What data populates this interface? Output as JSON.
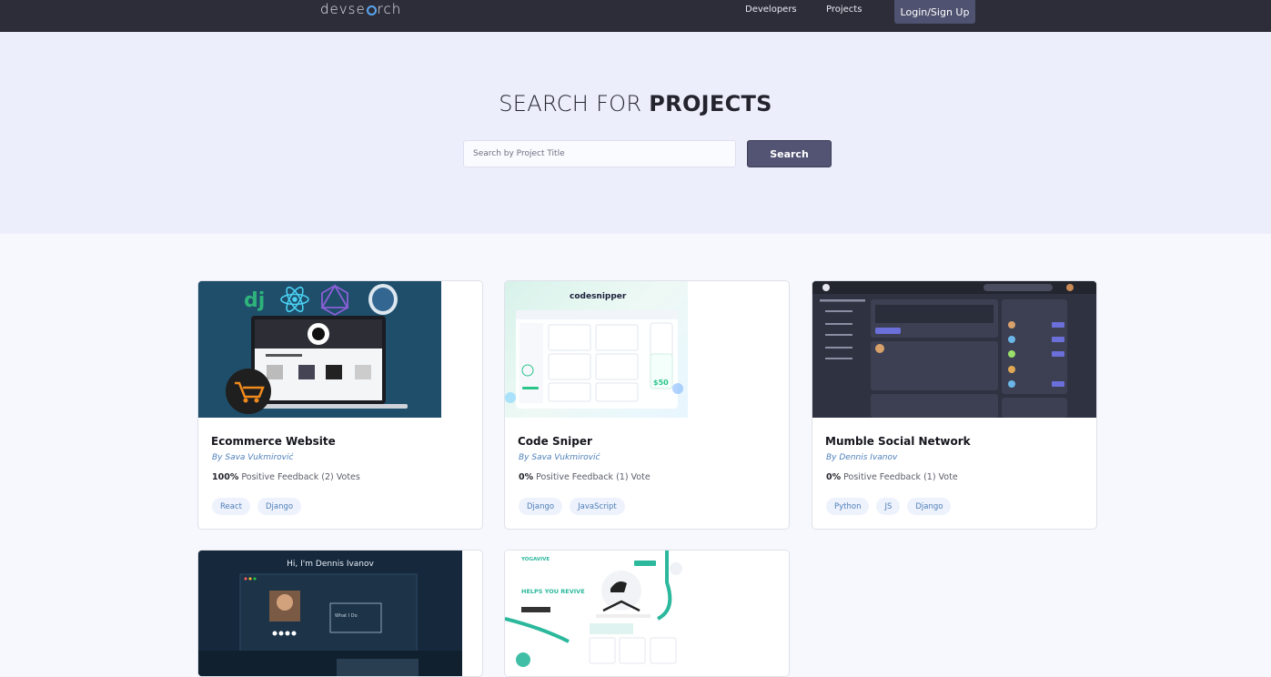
{
  "app": {
    "logo_prefix": "devse",
    "logo_suffix": "rch"
  },
  "nav": {
    "developers": "Developers",
    "projects": "Projects",
    "login": "Login/Sign Up"
  },
  "hero": {
    "title_light": "SEARCH FOR ",
    "title_bold": "PROJECTS",
    "search_placeholder": "Search by Project Title",
    "search_button": "Search"
  },
  "projects": [
    {
      "title": "Ecommerce Website",
      "author": "By Sava Vukmirović",
      "percent": "100%",
      "feedback": " Positive Feedback (2) Votes",
      "tags": [
        "React",
        "Django"
      ],
      "thumb_badges": [
        "dj"
      ]
    },
    {
      "title": "Code Sniper",
      "author": "By Sava Vukmirović",
      "percent": "0%",
      "feedback": " Positive Feedback (1) Vote",
      "tags": [
        "Django",
        "JavaScript"
      ],
      "thumb_brand": "codesnipper",
      "thumb_price": "$50"
    },
    {
      "title": "Mumble Social Network",
      "author": "By Dennis Ivanov",
      "percent": "0%",
      "feedback": " Positive Feedback (1) Vote",
      "tags": [
        "Python",
        "JS",
        "Django"
      ]
    },
    {
      "thumb_heading": "Hi, I'm Dennis Ivanov",
      "thumb_whatido": "What I Do"
    },
    {
      "thumb_brand": "YOGAVIVE",
      "thumb_heading": "HELPS YOU REVIVE"
    }
  ],
  "colors": {
    "navbar": "#2d2d39",
    "hero_bg": "#eceefb",
    "accent": "#535474",
    "tag_text": "#4d7fb9"
  }
}
